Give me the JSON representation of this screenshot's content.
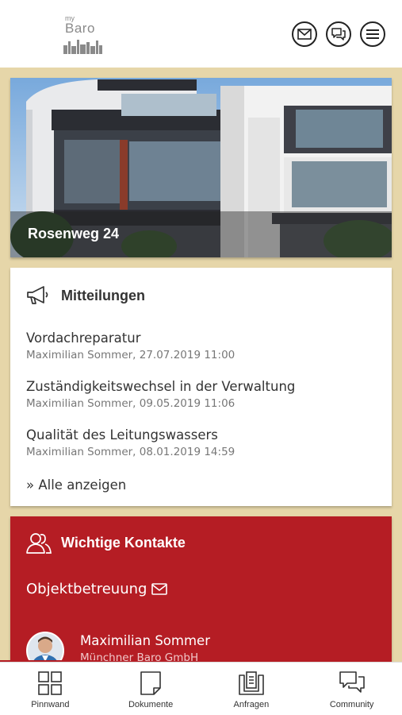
{
  "header": {
    "logo_small": "my",
    "logo_name": "Baro",
    "icons": [
      "mail-icon",
      "chat-icon",
      "menu-icon"
    ]
  },
  "property": {
    "name": "Rosenweg 24"
  },
  "notices": {
    "title": "Mitteilungen",
    "items": [
      {
        "title": "Vordachreparatur",
        "meta": "Maximilian Sommer, 27.07.2019 11:00"
      },
      {
        "title": "Zuständigkeitswechsel in der Verwaltung",
        "meta": "Maximilian Sommer, 09.05.2019 11:06"
      },
      {
        "title": "Qualität des Leitungswassers",
        "meta": "Maximilian Sommer, 08.01.2019 14:59"
      }
    ],
    "show_all": "» Alle anzeigen"
  },
  "contacts": {
    "title": "Wichtige Kontakte",
    "category": "Objektbetreuung",
    "person": {
      "name": "Maximilian Sommer",
      "company": "Münchner Baro GmbH"
    }
  },
  "nav": {
    "tabs": [
      {
        "label": "Pinnwand",
        "icon": "grid-icon"
      },
      {
        "label": "Dokumente",
        "icon": "document-icon"
      },
      {
        "label": "Anfragen",
        "icon": "inbox-icon"
      },
      {
        "label": "Community",
        "icon": "chat-icon"
      }
    ]
  },
  "colors": {
    "accent": "#b51d24",
    "background": "#e6d6a9"
  }
}
